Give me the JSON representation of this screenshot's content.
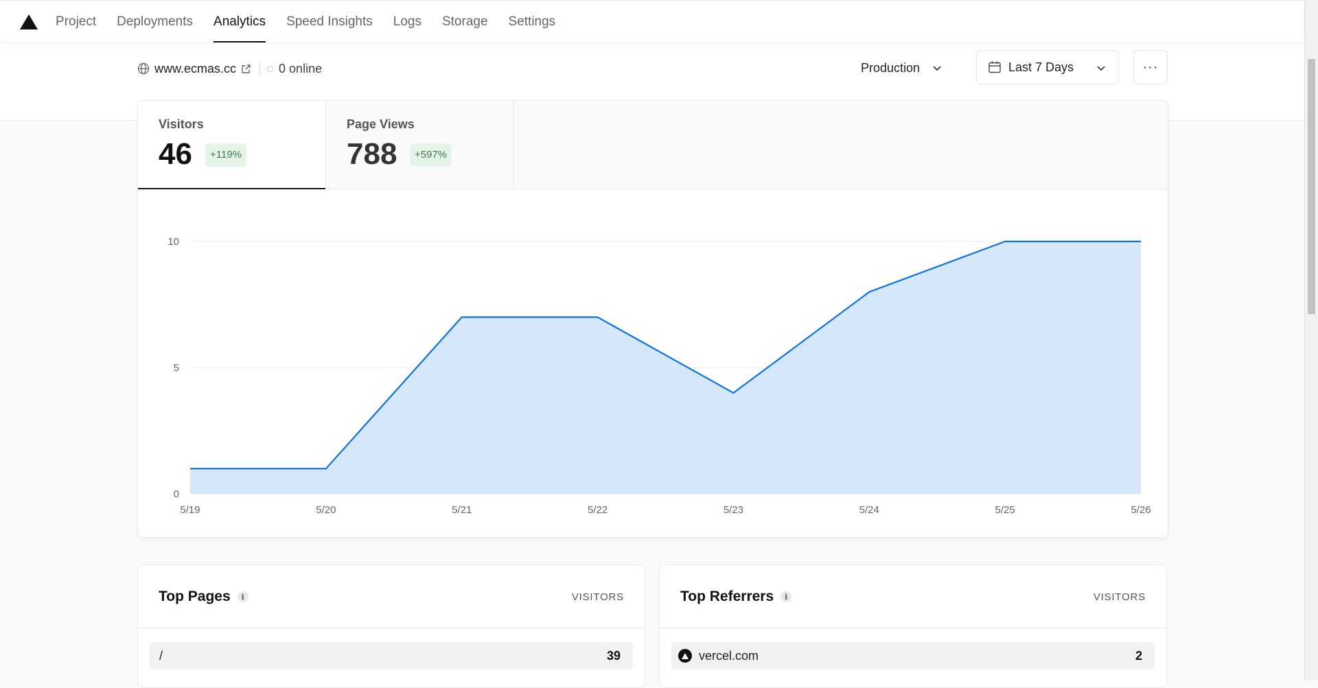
{
  "nav": {
    "tabs": [
      {
        "label": "Project"
      },
      {
        "label": "Deployments"
      },
      {
        "label": "Analytics",
        "active": true
      },
      {
        "label": "Speed Insights"
      },
      {
        "label": "Logs"
      },
      {
        "label": "Storage"
      },
      {
        "label": "Settings"
      }
    ]
  },
  "header": {
    "domain": "www.ecmas.cc",
    "online": "0 online",
    "environment": "Production",
    "date_range": "Last 7 Days",
    "more_label": "···"
  },
  "stats": {
    "visitors": {
      "label": "Visitors",
      "value": "46",
      "change": "+119%"
    },
    "page_views": {
      "label": "Page Views",
      "value": "788",
      "change": "+597%"
    }
  },
  "chart_data": {
    "type": "area",
    "x": [
      "5/19",
      "5/20",
      "5/21",
      "5/22",
      "5/23",
      "5/24",
      "5/25",
      "5/26"
    ],
    "values": [
      1,
      1,
      7,
      7,
      4,
      8,
      10,
      10
    ],
    "yticks": [
      0,
      5,
      10
    ],
    "ylim": [
      0,
      10
    ],
    "grid": true,
    "color": "#0a72e3",
    "fill": "#d6e7f9"
  },
  "top_pages": {
    "title": "Top Pages",
    "column": "VISITORS",
    "rows": [
      {
        "label": "/",
        "value": "39"
      }
    ]
  },
  "top_referrers": {
    "title": "Top Referrers",
    "column": "VISITORS",
    "rows": [
      {
        "label": "vercel.com",
        "value": "2"
      }
    ]
  },
  "colors": {
    "accent": "#0a72e3",
    "badge_bg": "#e6f4e8",
    "badge_text": "#3c7a4f"
  }
}
